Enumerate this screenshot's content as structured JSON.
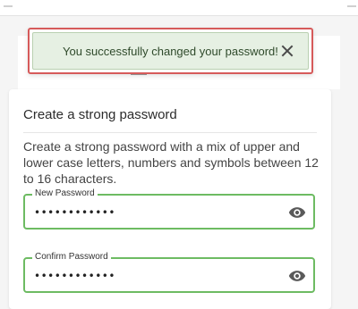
{
  "toast": {
    "message": "You successfully changed your password!",
    "close_icon": "close-icon"
  },
  "card": {
    "title": "Create a strong password",
    "description": "Create a strong password with a mix of upper and lower case letters, numbers and symbols between 12 to 16 characters."
  },
  "fields": {
    "new_password": {
      "label": "New Password",
      "value": "••••••••••••",
      "icon": "eye-icon"
    },
    "confirm_password": {
      "label": "Confirm Password",
      "value": "••••••••••••",
      "icon": "eye-icon"
    }
  },
  "colors": {
    "toast_bg": "#e6f0e3",
    "highlight_border": "#d65a5a",
    "field_border": "#6dbb62"
  }
}
